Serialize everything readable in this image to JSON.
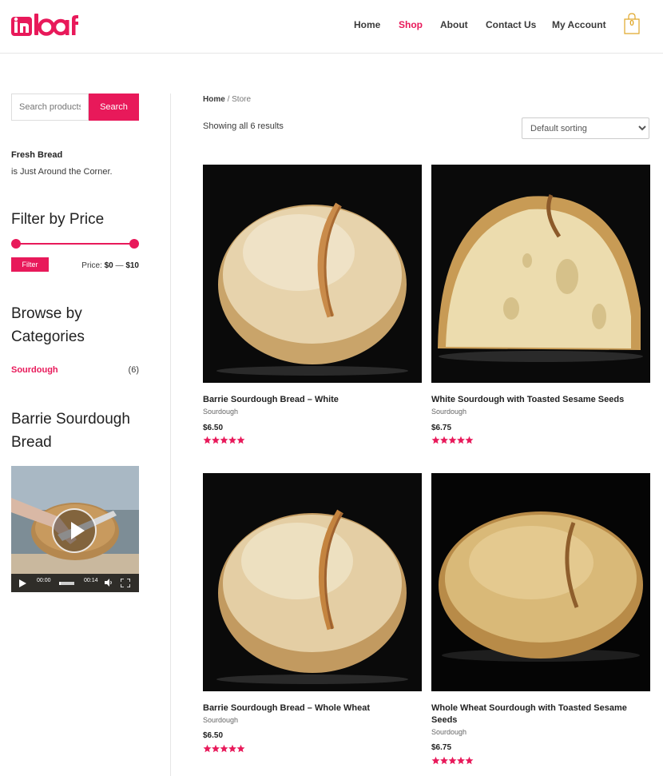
{
  "header": {
    "logo_text": "inloaf",
    "nav": [
      {
        "label": "Home",
        "active": false
      },
      {
        "label": "Shop",
        "active": true
      },
      {
        "label": "About",
        "active": false
      },
      {
        "label": "Contact Us",
        "active": false
      },
      {
        "label": "My Account",
        "active": false
      }
    ],
    "cart_count": "0",
    "accent_color": "#e8195a"
  },
  "sidebar": {
    "search": {
      "placeholder": "Search products…",
      "button_label": "Search"
    },
    "promo": {
      "bold": "Fresh Bread",
      "text": "is Just Around the Corner."
    },
    "price_filter": {
      "title": "Filter by Price",
      "button_label": "Filter",
      "price_prefix": "Price:",
      "min": "$0",
      "separator": "—",
      "max": "$10"
    },
    "categories": {
      "title": "Browse by Categories",
      "items": [
        {
          "label": "Sourdough",
          "count": "(6)"
        }
      ]
    },
    "video_widget": {
      "title": "Barrie Sourdough Bread",
      "current_time": "00:00",
      "duration": "00:14",
      "progress": 0.0
    }
  },
  "main": {
    "breadcrumb": {
      "home": "Home",
      "separator": "/",
      "current": "Store"
    },
    "results_text": "Showing all 6 results",
    "sort": {
      "selected": "Default sorting"
    },
    "products": [
      {
        "title": "Barrie Sourdough Bread – White",
        "category": "Sourdough",
        "price": "$6.50",
        "rating": 5,
        "rating_label": "Rated 5.00 out of 5",
        "image": "white-loaf-round"
      },
      {
        "title": "White Sourdough with Toasted Sesame Seeds",
        "category": "Sourdough",
        "price": "$6.75",
        "rating": 5,
        "rating_label": "Rated 5.00 out of 5",
        "image": "sesame-loaf-cut"
      },
      {
        "title": "Barrie Sourdough Bread – Whole Wheat",
        "category": "Sourdough",
        "price": "$6.50",
        "rating": 5,
        "rating_label": "Rated 5.00 out of 5",
        "image": "wheat-loaf-round"
      },
      {
        "title": "Whole Wheat Sourdough with Toasted Sesame Seeds",
        "category": "Sourdough",
        "price": "$6.75",
        "rating": 5,
        "rating_label": "Rated 5.00 out of 5",
        "image": "sesame-loaf-whole"
      }
    ]
  }
}
